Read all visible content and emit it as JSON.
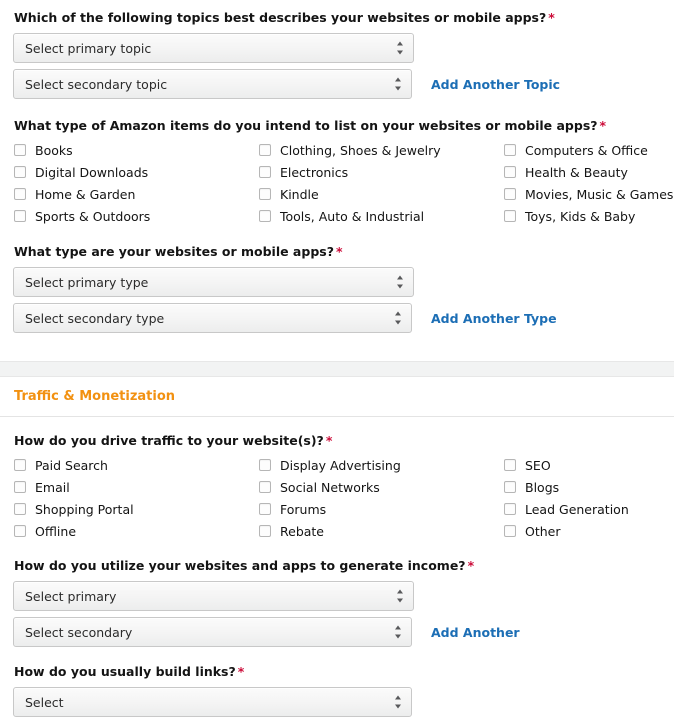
{
  "sections": [
    {
      "id": "websites",
      "questions": {
        "topics": {
          "label": "Which of the following topics best describes your websites or mobile apps?",
          "required_mark": "*",
          "primary_value": "Select primary topic",
          "secondary_value": "Select secondary topic",
          "add_link": "Add Another Topic"
        },
        "items": {
          "label": "What type of Amazon items do you intend to list on your websites or mobile apps?",
          "required_mark": "*",
          "options": [
            [
              "Books",
              "Clothing, Shoes & Jewelry",
              "Computers & Office"
            ],
            [
              "Digital Downloads",
              "Electronics",
              "Health & Beauty"
            ],
            [
              "Home & Garden",
              "Kindle",
              "Movies, Music & Games"
            ],
            [
              "Sports & Outdoors",
              "Tools, Auto & Industrial",
              "Toys, Kids & Baby"
            ]
          ]
        },
        "type": {
          "label": "What type are your websites or mobile apps?",
          "required_mark": "*",
          "primary_value": "Select primary type",
          "secondary_value": "Select secondary type",
          "add_link": "Add Another Type"
        }
      }
    },
    {
      "id": "traffic",
      "title": "Traffic & Monetization",
      "questions": {
        "traffic": {
          "label": "How do you drive traffic to your website(s)?",
          "required_mark": "*",
          "options": [
            [
              "Paid Search",
              "Display Advertising",
              "SEO"
            ],
            [
              "Email",
              "Social Networks",
              "Blogs"
            ],
            [
              "Shopping Portal",
              "Forums",
              "Lead Generation"
            ],
            [
              "Offline",
              "Rebate",
              "Other"
            ]
          ]
        },
        "income": {
          "label": "How do you utilize your websites and apps to generate income?",
          "required_mark": "*",
          "primary_value": "Select primary",
          "secondary_value": "Select secondary",
          "add_link": "Add Another"
        },
        "links": {
          "label": "How do you usually build links?",
          "required_mark": "*",
          "value": "Select"
        }
      }
    }
  ],
  "colors": {
    "accent_orange": "#f29111",
    "link_blue": "#1c6eb5",
    "required_red": "#cc0c39"
  },
  "icons": {
    "select_arrows": "up-down-arrows-icon",
    "checkbox": "checkbox-icon"
  }
}
